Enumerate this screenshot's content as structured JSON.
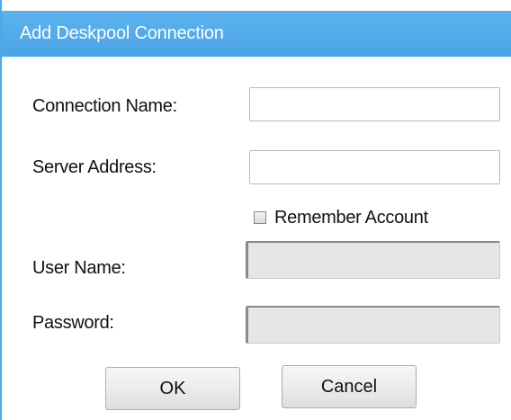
{
  "dialog": {
    "title": "Add Deskpool Connection"
  },
  "form": {
    "connection_name_label": "Connection Name:",
    "connection_name_value": "",
    "server_address_label": "Server Address:",
    "server_address_value": "",
    "remember_account_label": "Remember Account",
    "remember_account_checked": false,
    "user_name_label": "User Name:",
    "user_name_value": "",
    "password_label": "Password:",
    "password_value": ""
  },
  "buttons": {
    "ok_label": "OK",
    "cancel_label": "Cancel"
  },
  "colors": {
    "title_bar": "#4da7e8",
    "disabled_field": "#e6e6e6"
  }
}
